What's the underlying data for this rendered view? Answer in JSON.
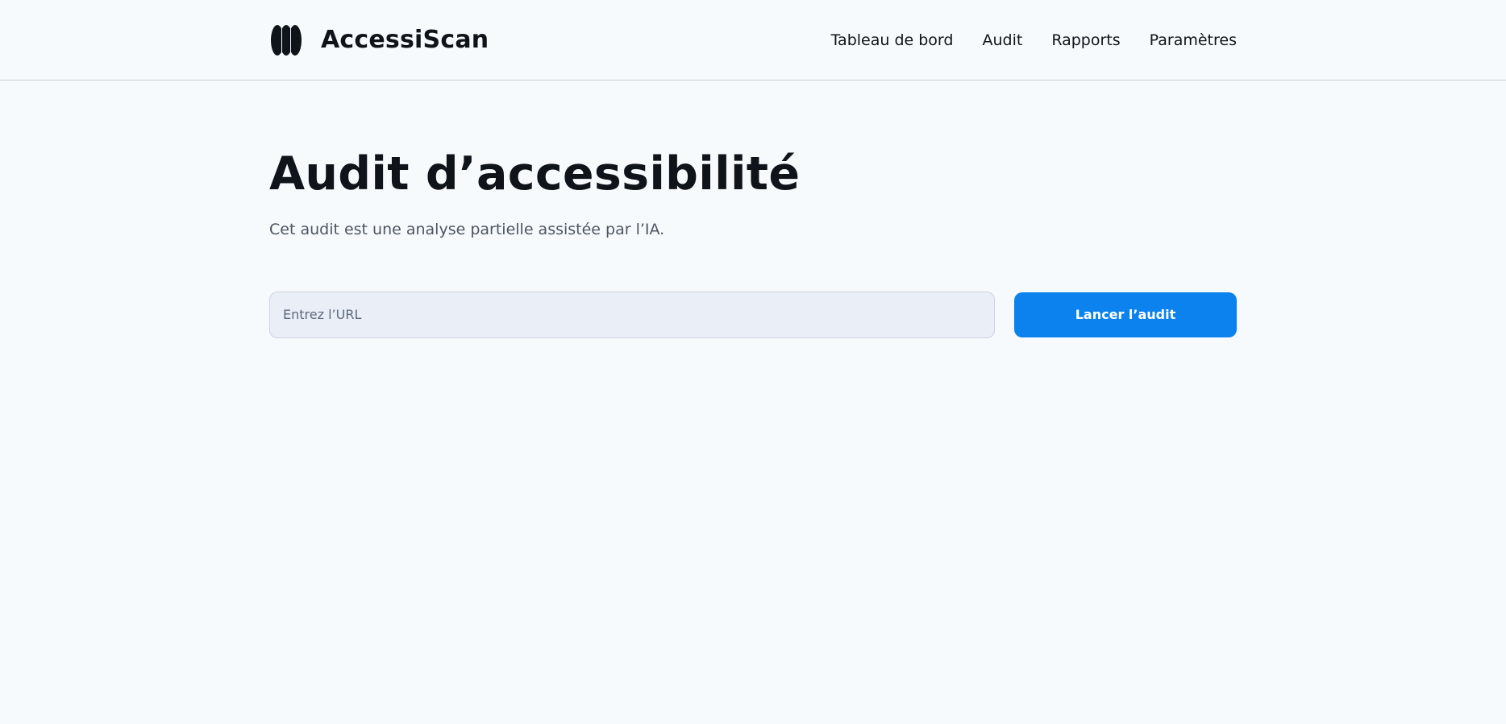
{
  "header": {
    "brand_name": "AccessiScan",
    "logo_icon": "three-ovals-logo-icon",
    "nav": [
      {
        "label": "Tableau de bord"
      },
      {
        "label": "Audit"
      },
      {
        "label": "Rapports"
      },
      {
        "label": "Paramètres"
      }
    ]
  },
  "main": {
    "title": "Audit d’accessibilité",
    "subtitle": "Cet audit est une analyse partielle assistée par l’IA.",
    "url_input": {
      "placeholder": "Entrez l’URL",
      "value": ""
    },
    "launch_label": "Lancer l’audit"
  },
  "colors": {
    "background": "#f6fafd",
    "primary": "#0b82ee",
    "text": "#0f141a",
    "muted": "#4d5561",
    "input_bg": "#e9eef7"
  }
}
